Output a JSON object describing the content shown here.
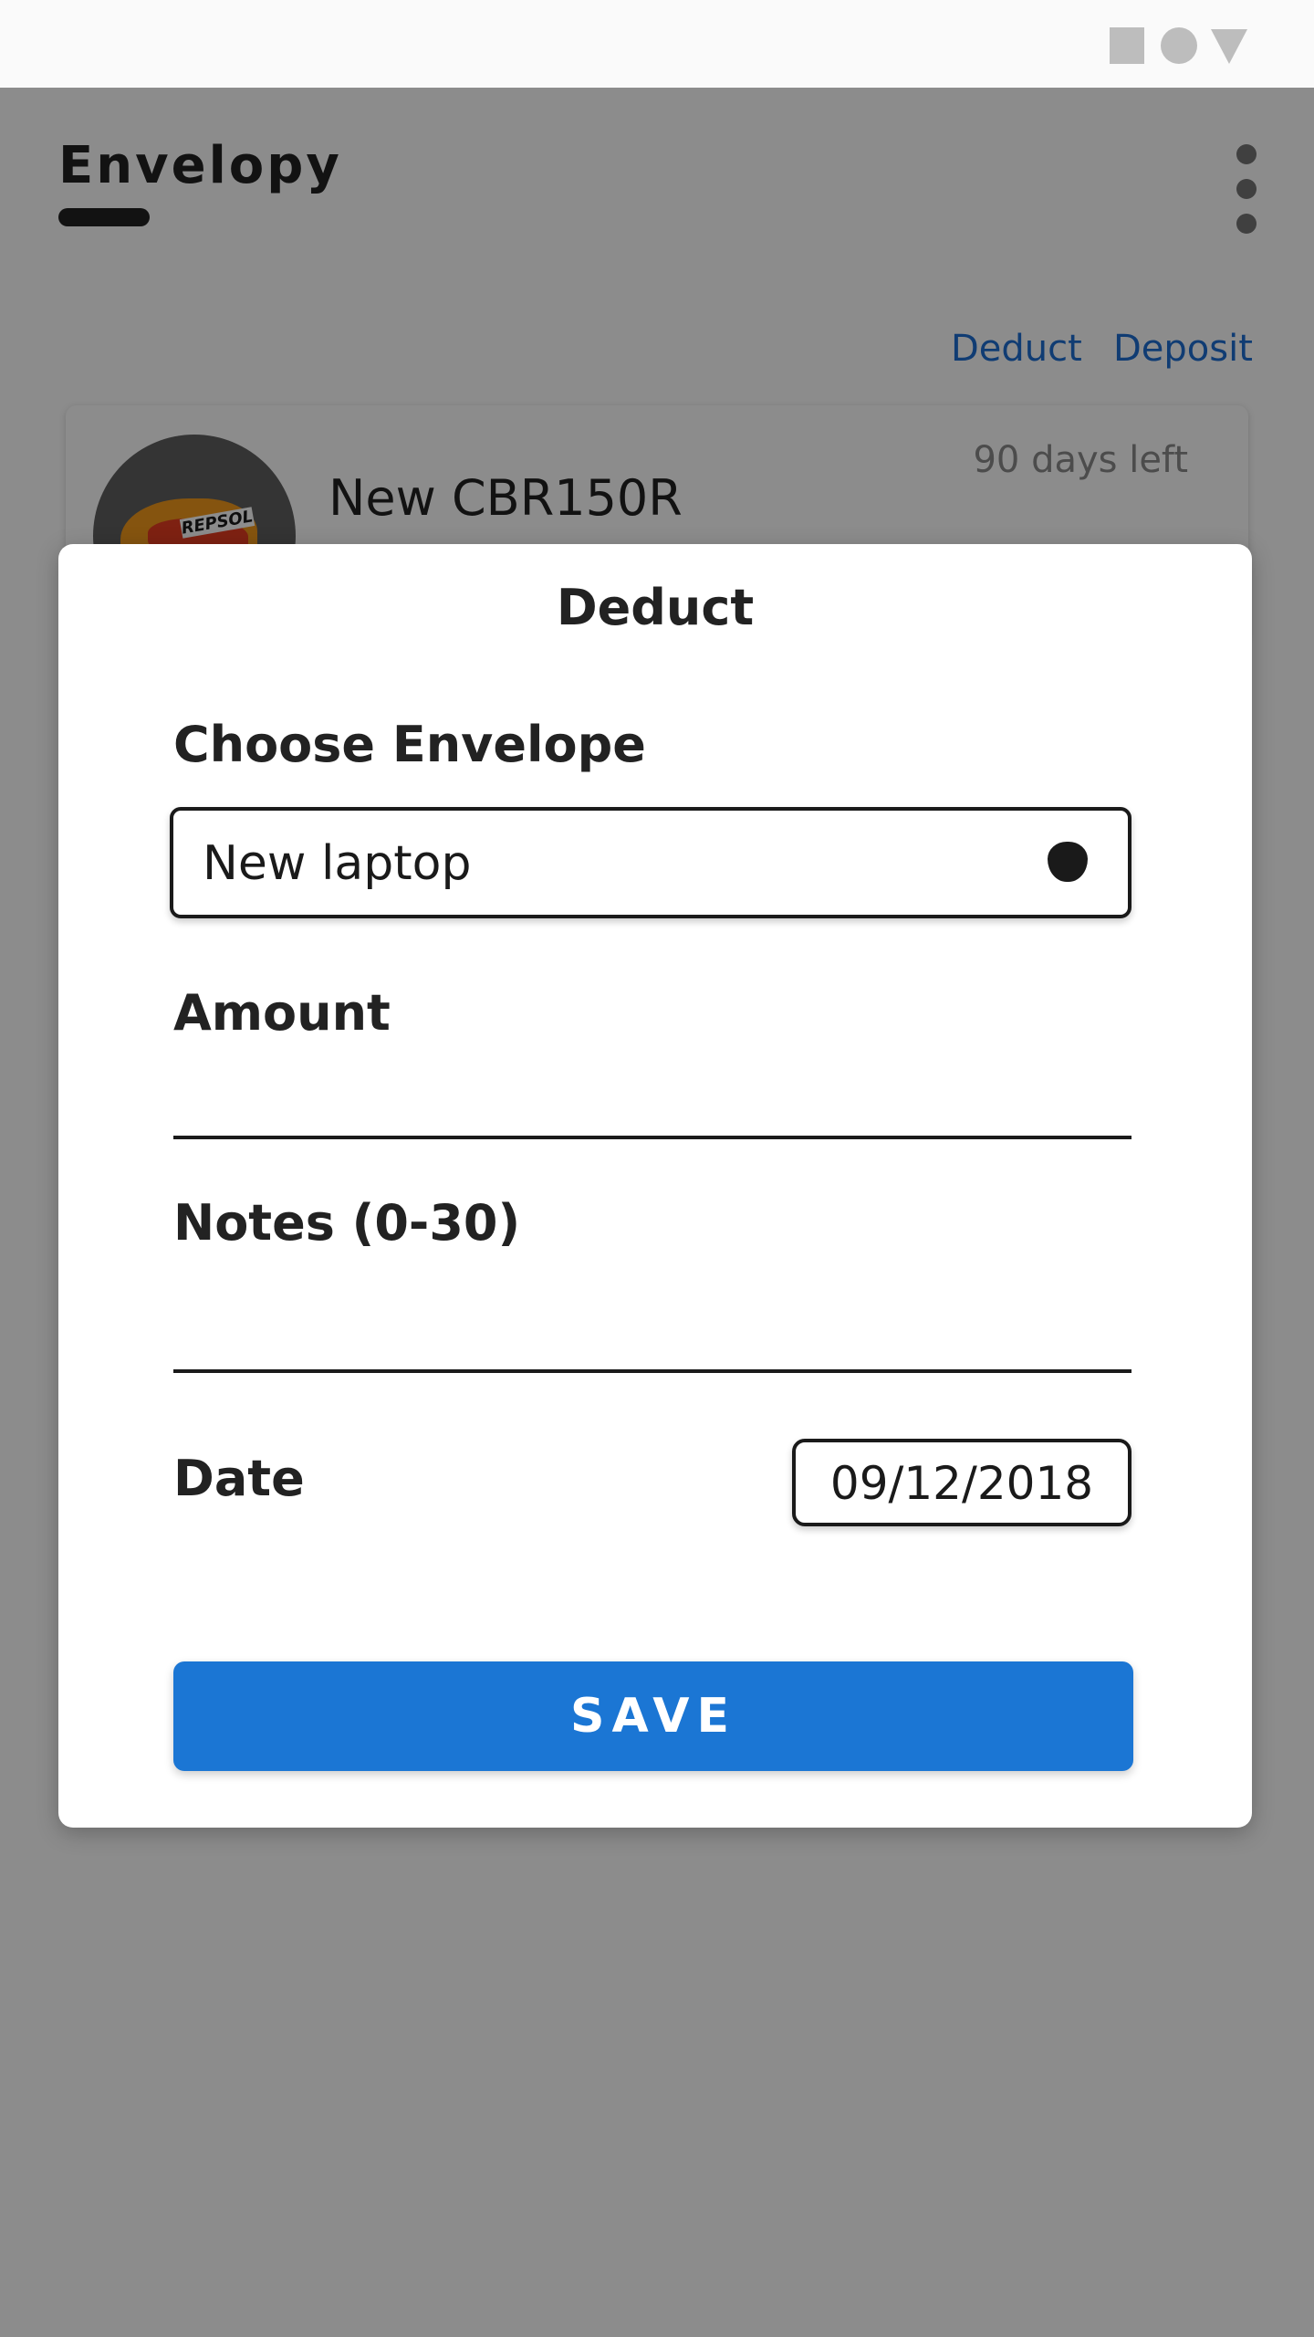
{
  "status_bar": {
    "icons": [
      "square-icon",
      "circle-icon",
      "triangle-icon"
    ]
  },
  "app": {
    "title": "Envelopy",
    "menu_icon": "more-vert-icon",
    "actions": {
      "deduct_label": "Deduct",
      "deposit_label": "Deposit"
    },
    "envelope": {
      "name": "New CBR150R",
      "days_left": "90 days left",
      "avatar_logo": "REPSOL"
    }
  },
  "dialog": {
    "title": "Deduct",
    "choose_envelope_label": "Choose Envelope",
    "selected_envelope": "New laptop",
    "amount_label": "Amount",
    "amount_value": "",
    "notes_label": "Notes (0-30)",
    "notes_value": "",
    "date_label": "Date",
    "date_value": "09/12/2018",
    "save_label": "SAVE"
  },
  "colors": {
    "accent": "#1b76d4",
    "link": "#1e6ed2",
    "text": "#222222",
    "muted": "#8a8a8a"
  }
}
